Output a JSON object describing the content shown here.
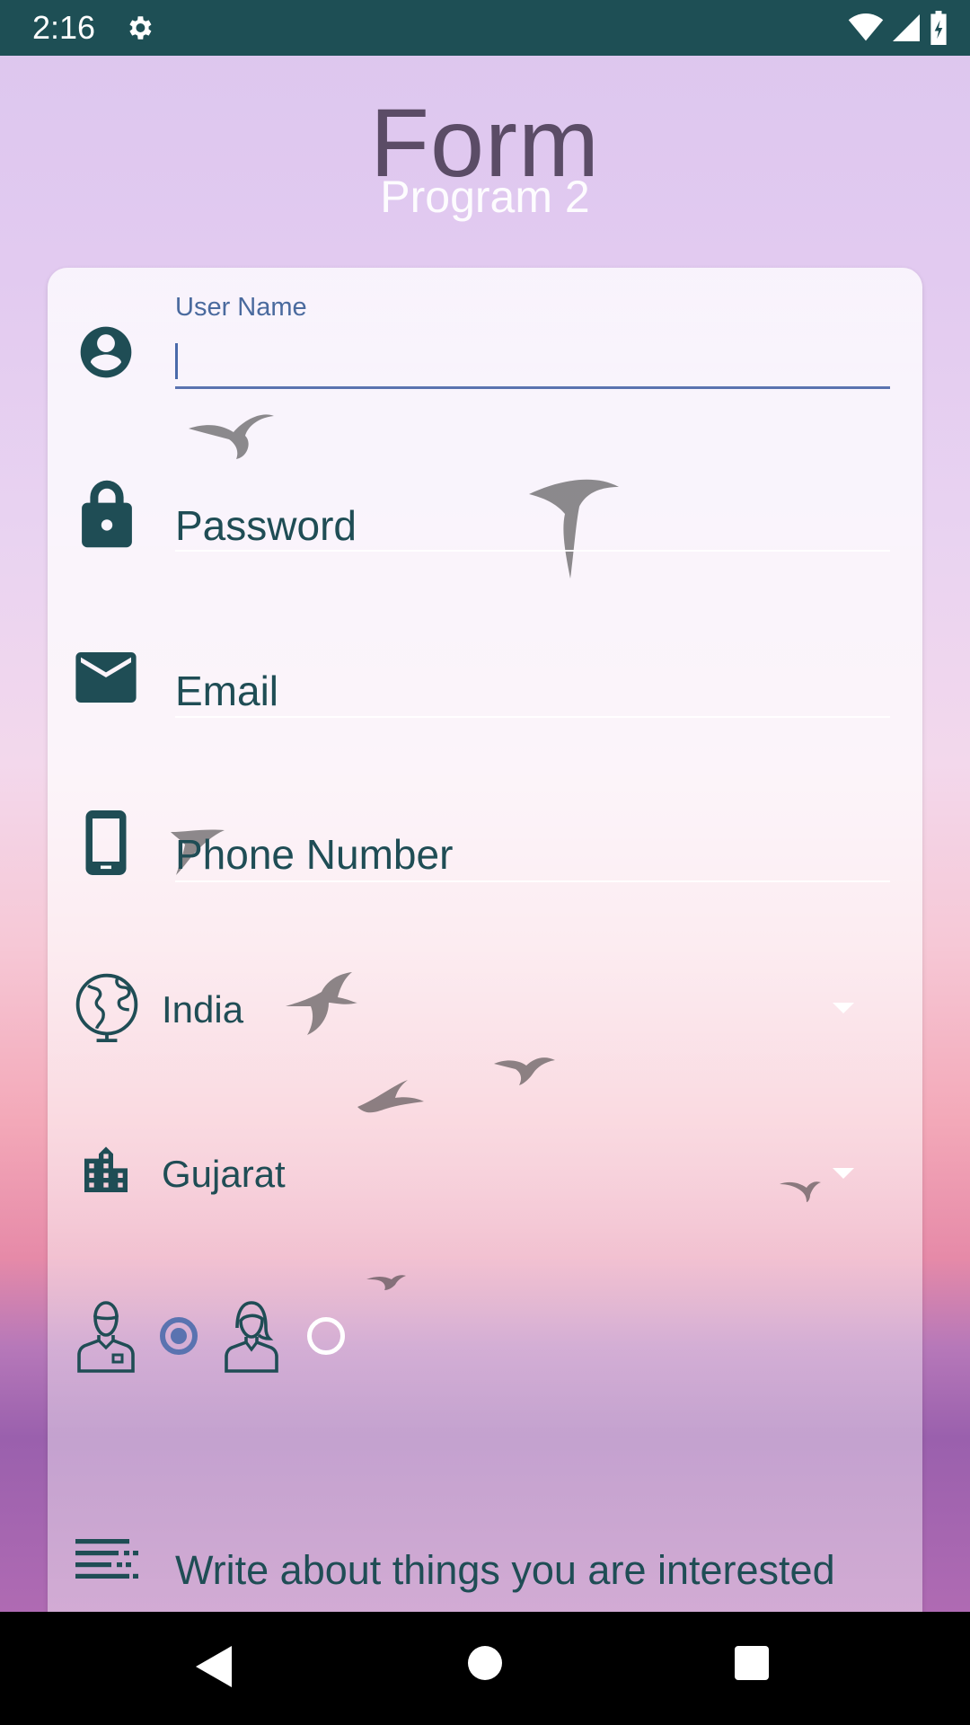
{
  "status_bar": {
    "time": "2:16"
  },
  "header": {
    "title": "Form",
    "subtitle": "Program 2"
  },
  "form": {
    "username": {
      "label": "User Name",
      "value": ""
    },
    "password": {
      "placeholder": "Password"
    },
    "email": {
      "placeholder": "Email"
    },
    "phone": {
      "placeholder": "Phone Number"
    },
    "country": {
      "selected": "India"
    },
    "state": {
      "selected": "Gujarat"
    },
    "gender": {
      "options": [
        "male",
        "female"
      ],
      "selected": "male"
    },
    "interests": {
      "placeholder": "Write about things you are interested"
    }
  },
  "colors": {
    "status_bar": "#1e4f55",
    "icon": "#1f4d55",
    "accent": "#5a73b0",
    "title": "#5b4c66"
  },
  "icons": [
    "settings-icon",
    "wifi-icon",
    "signal-icon",
    "battery-icon",
    "account-icon",
    "lock-icon",
    "email-icon",
    "phone-icon",
    "globe-icon",
    "city-icon",
    "male-icon",
    "female-icon",
    "notes-icon"
  ]
}
